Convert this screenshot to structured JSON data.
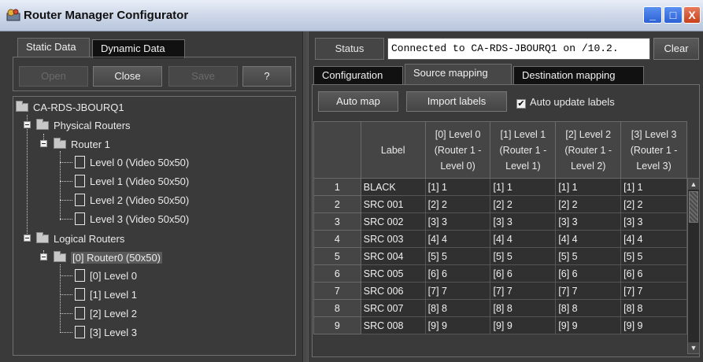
{
  "window": {
    "title": "Router Manager Configurator",
    "minimize": "_",
    "maximize": "□",
    "close": "X"
  },
  "left": {
    "tabs": [
      "Static Data",
      "Dynamic Data"
    ],
    "buttons": {
      "open": "Open",
      "close": "Close",
      "save": "Save",
      "help": "?"
    },
    "tree": {
      "root": "CA-RDS-JBOURQ1",
      "physical": "Physical Routers",
      "router1": "Router 1",
      "levels": [
        "Level 0 (Video 50x50)",
        "Level 1 (Video 50x50)",
        "Level 2 (Video 50x50)",
        "Level 3 (Video 50x50)"
      ],
      "logical": "Logical Routers",
      "router0": "[0] Router0 (50x50)",
      "logical_levels": [
        "[0] Level 0",
        "[1] Level 1",
        "[2] Level 2",
        "[3] Level 3"
      ]
    }
  },
  "right": {
    "status_label": "Status",
    "status_value": "Connected to CA-RDS-JBOURQ1 on /10.2.",
    "clear_label": "Clear",
    "tabs": [
      "Configuration",
      "Source mapping",
      "Destination mapping"
    ],
    "auto_map": "Auto map",
    "import_labels": "Import labels",
    "auto_update_labels": "Auto update labels",
    "auto_update_checked": "✔",
    "columns": [
      "",
      "Label",
      "[0] Level 0 (Router 1 - Level 0)",
      "[1] Level 1 (Router 1 - Level 1)",
      "[2] Level 2 (Router 1 - Level 2)",
      "[3] Level 3 (Router 1 - Level 3)"
    ],
    "rows": [
      [
        "1",
        "BLACK",
        "[1] 1",
        "[1] 1",
        "[1] 1",
        "[1] 1"
      ],
      [
        "2",
        "SRC 001",
        "[2] 2",
        "[2] 2",
        "[2] 2",
        "[2] 2"
      ],
      [
        "3",
        "SRC 002",
        "[3] 3",
        "[3] 3",
        "[3] 3",
        "[3] 3"
      ],
      [
        "4",
        "SRC 003",
        "[4] 4",
        "[4] 4",
        "[4] 4",
        "[4] 4"
      ],
      [
        "5",
        "SRC 004",
        "[5] 5",
        "[5] 5",
        "[5] 5",
        "[5] 5"
      ],
      [
        "6",
        "SRC 005",
        "[6] 6",
        "[6] 6",
        "[6] 6",
        "[6] 6"
      ],
      [
        "7",
        "SRC 006",
        "[7] 7",
        "[7] 7",
        "[7] 7",
        "[7] 7"
      ],
      [
        "8",
        "SRC 007",
        "[8] 8",
        "[8] 8",
        "[8] 8",
        "[8] 8"
      ],
      [
        "9",
        "SRC 008",
        "[9] 9",
        "[9] 9",
        "[9] 9",
        "[9] 9"
      ]
    ]
  }
}
